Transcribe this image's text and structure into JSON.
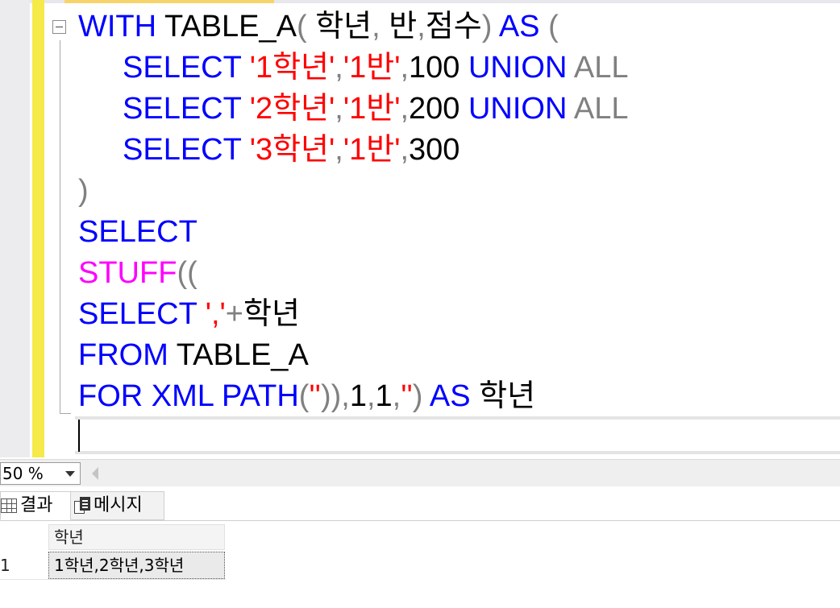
{
  "editor": {
    "lines": [
      [
        {
          "t": "WITH",
          "c": "kw"
        },
        {
          "t": " TABLE_A",
          "c": "id"
        },
        {
          "t": "(",
          "c": "op"
        },
        {
          "t": " 학년",
          "c": "id"
        },
        {
          "t": ",",
          "c": "op"
        },
        {
          "t": " 반",
          "c": "id"
        },
        {
          "t": ",",
          "c": "op"
        },
        {
          "t": "점수",
          "c": "id"
        },
        {
          "t": ")",
          "c": "op"
        },
        {
          "t": " AS",
          "c": "kw"
        },
        {
          "t": " (",
          "c": "op"
        }
      ],
      [
        {
          "t": "SELECT",
          "c": "kw"
        },
        {
          "t": " ",
          "c": "id"
        },
        {
          "t": "'1학년'",
          "c": "str"
        },
        {
          "t": ",",
          "c": "op"
        },
        {
          "t": "'1반'",
          "c": "str"
        },
        {
          "t": ",",
          "c": "op"
        },
        {
          "t": "100",
          "c": "id"
        },
        {
          "t": " UNION",
          "c": "kw"
        },
        {
          "t": " ALL",
          "c": "op"
        }
      ],
      [
        {
          "t": "SELECT",
          "c": "kw"
        },
        {
          "t": " ",
          "c": "id"
        },
        {
          "t": "'2학년'",
          "c": "str"
        },
        {
          "t": ",",
          "c": "op"
        },
        {
          "t": "'1반'",
          "c": "str"
        },
        {
          "t": ",",
          "c": "op"
        },
        {
          "t": "200",
          "c": "id"
        },
        {
          "t": " UNION",
          "c": "kw"
        },
        {
          "t": " ALL",
          "c": "op"
        }
      ],
      [
        {
          "t": "SELECT",
          "c": "kw"
        },
        {
          "t": " ",
          "c": "id"
        },
        {
          "t": "'3학년'",
          "c": "str"
        },
        {
          "t": ",",
          "c": "op"
        },
        {
          "t": "'1반'",
          "c": "str"
        },
        {
          "t": ",",
          "c": "op"
        },
        {
          "t": "300",
          "c": "id"
        }
      ],
      [
        {
          "t": ")",
          "c": "op"
        }
      ],
      [
        {
          "t": "SELECT",
          "c": "kw"
        }
      ],
      [
        {
          "t": "STUFF",
          "c": "fn"
        },
        {
          "t": "((",
          "c": "op"
        }
      ],
      [
        {
          "t": "SELECT",
          "c": "kw"
        },
        {
          "t": " ",
          "c": "id"
        },
        {
          "t": "','",
          "c": "str"
        },
        {
          "t": "+",
          "c": "op"
        },
        {
          "t": "학년",
          "c": "id"
        }
      ],
      [
        {
          "t": "FROM",
          "c": "kw"
        },
        {
          "t": " TABLE_A",
          "c": "id"
        }
      ],
      [
        {
          "t": "FOR",
          "c": "kw"
        },
        {
          "t": " XML",
          "c": "kw"
        },
        {
          "t": " PATH",
          "c": "kw"
        },
        {
          "t": "(",
          "c": "op"
        },
        {
          "t": "''",
          "c": "str"
        },
        {
          "t": ")),",
          "c": "op"
        },
        {
          "t": "1",
          "c": "id"
        },
        {
          "t": ",",
          "c": "op"
        },
        {
          "t": "1",
          "c": "id"
        },
        {
          "t": ",",
          "c": "op"
        },
        {
          "t": "''",
          "c": "str"
        },
        {
          "t": ")",
          "c": "op"
        },
        {
          "t": " AS",
          "c": "kw"
        },
        {
          "t": " 학년",
          "c": "id"
        }
      ]
    ],
    "indented_lines": [
      1,
      2,
      3
    ]
  },
  "zoom": {
    "value": "50 %"
  },
  "tabs": {
    "results_label": "결과",
    "messages_label": "메시지"
  },
  "grid": {
    "column_header": "학년",
    "rows": [
      {
        "num": "1",
        "value": "1학년,2학년,3학년"
      }
    ]
  },
  "colors": {
    "keyword": "#0000ff",
    "string": "#ff0000",
    "operator": "#808080",
    "function": "#ff00ff",
    "change_bar": "#f6e94a"
  }
}
